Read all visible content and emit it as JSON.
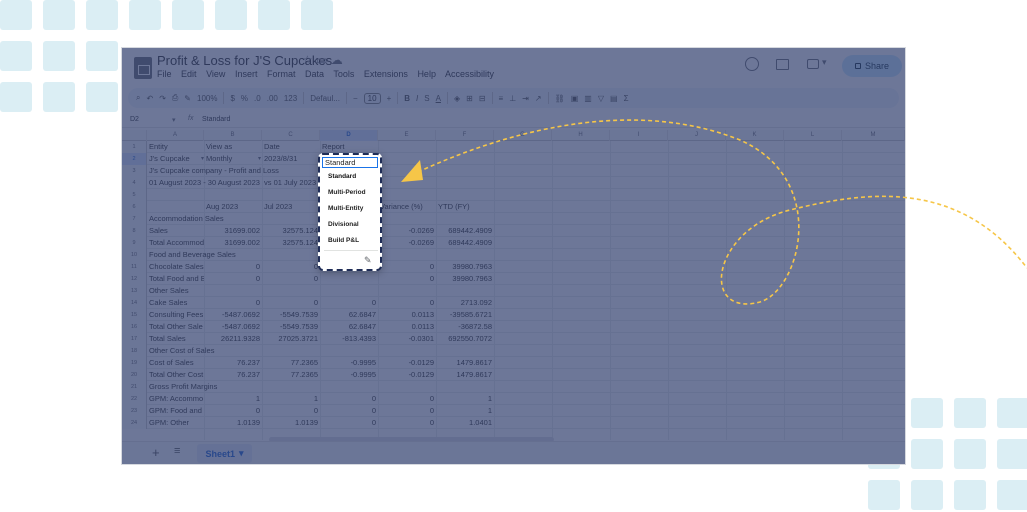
{
  "app": {
    "doc_title": "Profit & Loss for J'S Cupcakes",
    "menu": [
      "File",
      "Edit",
      "View",
      "Insert",
      "Format",
      "Data",
      "Tools",
      "Extensions",
      "Help",
      "Accessibility"
    ],
    "share_label": "Share"
  },
  "toolbar": {
    "zoom": "100%",
    "currency": "$",
    "percent": "%",
    "dec_decrease": ".0",
    "dec_increase": ".00",
    "number_format": "123",
    "font": "Defaul...",
    "font_size": "10",
    "bold": "B",
    "italic": "I",
    "strike": "S",
    "textcolor": "A",
    "sum": "Σ"
  },
  "formula_bar": {
    "cell_ref": "D2",
    "fx": "fx",
    "value": "Standard"
  },
  "columns": [
    "A",
    "B",
    "C",
    "D",
    "E",
    "F",
    "G",
    "H",
    "I",
    "J",
    "K",
    "L",
    "M"
  ],
  "rows": [
    {
      "n": "1",
      "a": "Entity",
      "b": "View as",
      "c": "Date",
      "d": "Report",
      "e": "",
      "f": ""
    },
    {
      "n": "2",
      "a": "J's Cupcake",
      "b": "Monthly",
      "c": "2023/8/31",
      "d": "Standard",
      "e": "",
      "f": ""
    },
    {
      "n": "3",
      "a": "J's Cupcake company - Profit and Loss",
      "b": "",
      "c": "",
      "d": "",
      "e": "",
      "f": ""
    },
    {
      "n": "4",
      "a": "01 August 2023 - 30 August 2023",
      "b": "",
      "c": "vs 01 July 2023",
      "d": "",
      "e": "",
      "f": ""
    },
    {
      "n": "5",
      "a": "",
      "b": "",
      "c": "",
      "d": "",
      "e": "",
      "f": ""
    },
    {
      "n": "6",
      "a": "",
      "b": "Aug 2023",
      "c": "Jul 2023",
      "d": "",
      "e": "Variance (%)",
      "f": "YTD (FY)"
    },
    {
      "n": "7",
      "a": "Accommodation Sales",
      "b": "",
      "c": "",
      "d": "",
      "e": "",
      "f": ""
    },
    {
      "n": "8",
      "a": "Sales",
      "b": "31699.002",
      "c": "32575.124",
      "d": "",
      "e": "-0.0269",
      "f": "689442.4909"
    },
    {
      "n": "9",
      "a": "Total Accommod",
      "b": "31699.002",
      "c": "32575.124",
      "d": "",
      "e": "-0.0269",
      "f": "689442.4909"
    },
    {
      "n": "10",
      "a": "Food and Beverage Sales",
      "b": "",
      "c": "",
      "d": "",
      "e": "",
      "f": ""
    },
    {
      "n": "11",
      "a": "Chocolate Sales",
      "b": "0",
      "c": "0",
      "d": "",
      "e": "0",
      "f": "39980.7963"
    },
    {
      "n": "12",
      "a": "Total Food and B",
      "b": "0",
      "c": "0",
      "d": "",
      "e": "0",
      "f": "39980.7963"
    },
    {
      "n": "13",
      "a": "Other Sales",
      "b": "",
      "c": "",
      "d": "",
      "e": "",
      "f": ""
    },
    {
      "n": "14",
      "a": "Cake Sales",
      "b": "0",
      "c": "0",
      "d": "0",
      "e": "0",
      "f": "2713.092"
    },
    {
      "n": "15",
      "a": "Consulting Fees",
      "b": "-5487.0692",
      "c": "-5549.7539",
      "d": "62.6847",
      "e": "0.0113",
      "f": "-39585.6721"
    },
    {
      "n": "16",
      "a": "Total Other Sale",
      "b": "-5487.0692",
      "c": "-5549.7539",
      "d": "62.6847",
      "e": "0.0113",
      "f": "-36872.58"
    },
    {
      "n": "17",
      "a": "Total Sales",
      "b": "26211.9328",
      "c": "27025.3721",
      "d": "-813.4393",
      "e": "-0.0301",
      "f": "692550.7072"
    },
    {
      "n": "18",
      "a": "Other Cost of Sales",
      "b": "",
      "c": "",
      "d": "",
      "e": "",
      "f": ""
    },
    {
      "n": "19",
      "a": "Cost of Sales",
      "b": "76.237",
      "c": "77.2365",
      "d": "-0.9995",
      "e": "-0.0129",
      "f": "1479.8617"
    },
    {
      "n": "20",
      "a": "Total Other Cost",
      "b": "76.237",
      "c": "77.2365",
      "d": "-0.9995",
      "e": "-0.0129",
      "f": "1479.8617"
    },
    {
      "n": "21",
      "a": "Gross Profit Margins",
      "b": "",
      "c": "",
      "d": "",
      "e": "",
      "f": ""
    },
    {
      "n": "22",
      "a": "GPM: Accommo",
      "b": "1",
      "c": "1",
      "d": "0",
      "e": "0",
      "f": "1"
    },
    {
      "n": "23",
      "a": "GPM: Food and",
      "b": "0",
      "c": "0",
      "d": "0",
      "e": "0",
      "f": "1"
    },
    {
      "n": "24",
      "a": "GPM: Other",
      "b": "1.0139",
      "c": "1.0139",
      "d": "0",
      "e": "0",
      "f": "1.0401"
    }
  ],
  "dropdown": {
    "current": "Standard",
    "options": [
      "Standard",
      "Multi-Period",
      "Multi-Entity",
      "Divisional",
      "Build P&L"
    ]
  },
  "sheet_tab": "Sheet1",
  "colors": {
    "overlay": "#344270",
    "accent_arrow": "#f6c648",
    "decor_squares": "#dbeef4"
  }
}
